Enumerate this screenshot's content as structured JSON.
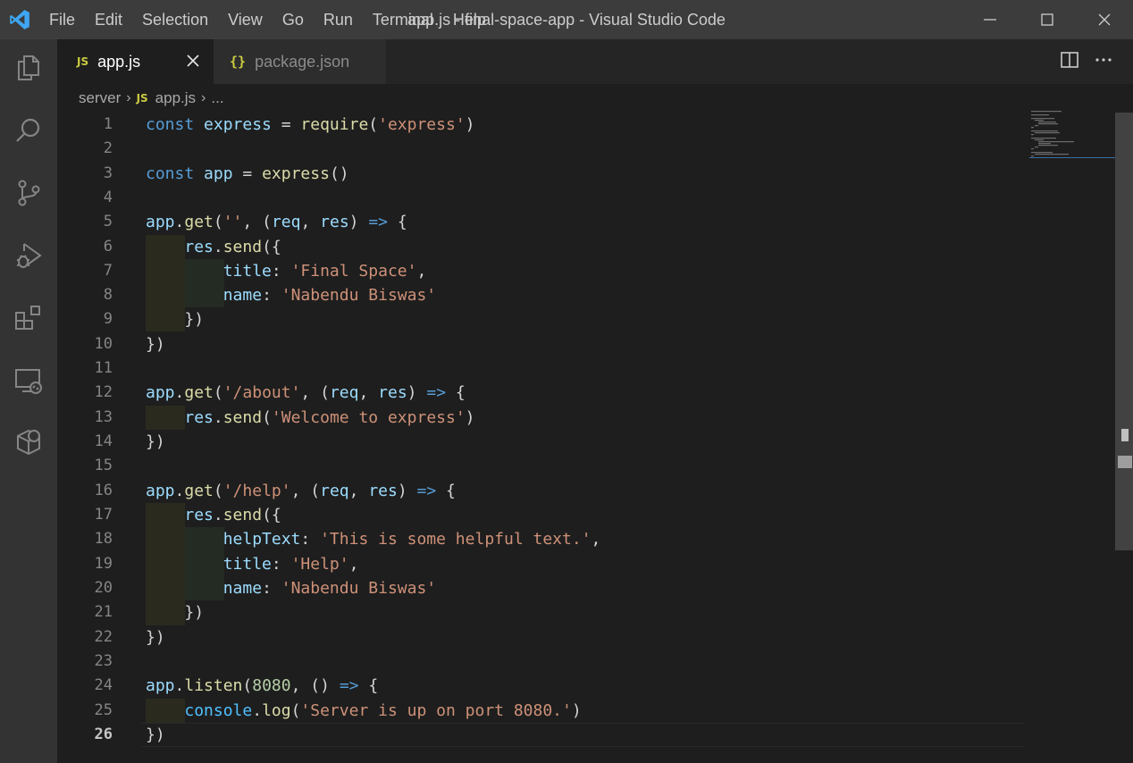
{
  "titlebar": {
    "menu": [
      "File",
      "Edit",
      "Selection",
      "View",
      "Go",
      "Run",
      "Terminal",
      "Help"
    ],
    "title": "app.js - final-space-app - Visual Studio Code"
  },
  "activity": [
    "explorer-icon",
    "search-icon",
    "source-control-icon",
    "run-debug-icon",
    "extensions-icon",
    "remote-explorer-icon",
    "docker-icon"
  ],
  "tabs": [
    {
      "icon": "JS",
      "label": "app.js",
      "active": true
    },
    {
      "icon": "{}",
      "label": "package.json",
      "active": false
    }
  ],
  "breadcrumb": {
    "folder": "server",
    "file_icon": "JS",
    "file": "app.js",
    "more": "..."
  },
  "editor": {
    "current_line": 26,
    "line_numbers": [
      "1",
      "2",
      "3",
      "4",
      "5",
      "6",
      "7",
      "8",
      "9",
      "10",
      "11",
      "12",
      "13",
      "14",
      "15",
      "16",
      "17",
      "18",
      "19",
      "20",
      "21",
      "22",
      "23",
      "24",
      "25",
      "26"
    ],
    "lines": [
      "const express = require('express')",
      "",
      "const app = express()",
      "",
      "app.get('', (req, res) => {",
      "    res.send({",
      "        title: 'Final Space',",
      "        name: 'Nabendu Biswas'",
      "    })",
      "})",
      "",
      "app.get('/about', (req, res) => {",
      "    res.send('Welcome to express')",
      "})",
      "",
      "app.get('/help', (req, res) => {",
      "    res.send({",
      "        helpText: 'This is some helpful text.',",
      "        title: 'Help',",
      "        name: 'Nabendu Biswas'",
      "    })",
      "})",
      "",
      "app.listen(8080, () => {",
      "    console.log('Server is up on port 8080.')",
      "})"
    ]
  },
  "colors": {
    "keyword": "#569cd6",
    "variable": "#9cdcfe",
    "function": "#dcdcaa",
    "string": "#ce9178",
    "number": "#b5cea8",
    "js_icon": "#cbcb41",
    "vscode_blue": "#3ea6f3"
  }
}
